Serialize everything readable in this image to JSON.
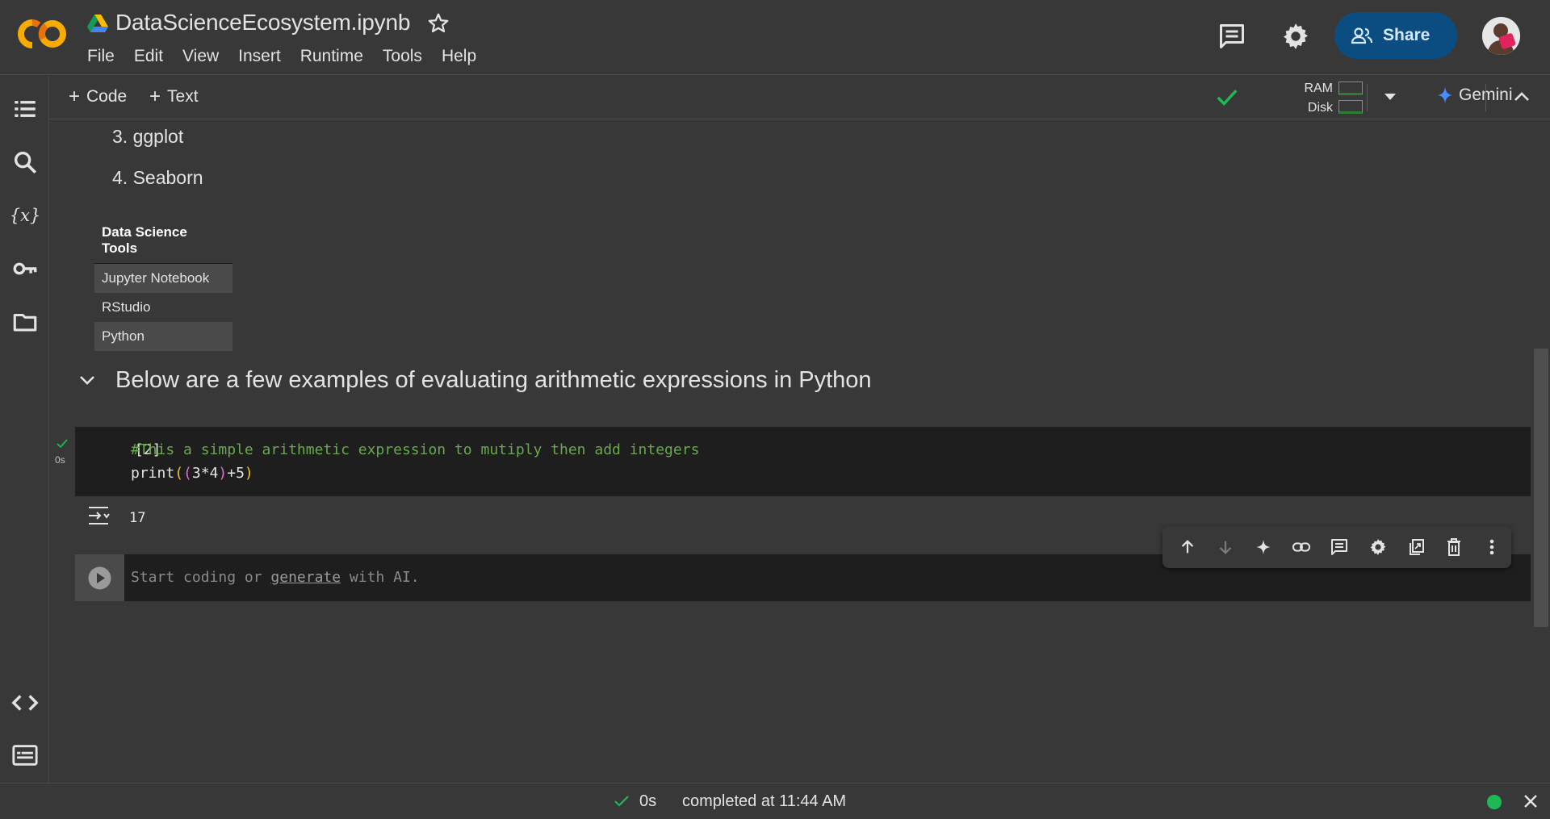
{
  "header": {
    "title": "DataScienceEcosystem.ipynb",
    "menu": [
      "File",
      "Edit",
      "View",
      "Insert",
      "Runtime",
      "Tools",
      "Help"
    ],
    "share_label": "Share",
    "logo_text": "CO",
    "icons": {
      "comments": "comment-icon",
      "settings": "gear-icon",
      "star": "star-icon",
      "drive": "google-drive-icon"
    }
  },
  "toolbar": {
    "add_code": "Code",
    "add_text": "Text",
    "ram_label": "RAM",
    "disk_label": "Disk",
    "gemini_label": "Gemini"
  },
  "notebook": {
    "list_items": [
      "3. ggplot",
      "4. Seaborn"
    ],
    "table": {
      "header": "Data Science Tools",
      "rows": [
        "Jupyter Notebook",
        "RStudio",
        "Python"
      ]
    },
    "section_heading": "Below are a few examples of evaluating arithmetic expressions in Python",
    "cell1": {
      "execution_count": "[2]",
      "duration": "0s",
      "code_line1": "#This a simple arithmetic expression to mutiply then add integers",
      "code_line2_fn": "print",
      "code_line2_inner": "3*4",
      "code_line2_tail": "+5",
      "output": "17"
    },
    "cell2": {
      "placeholder_start": "Start coding or ",
      "placeholder_link": "generate",
      "placeholder_end": " with AI."
    }
  },
  "status": {
    "duration": "0s",
    "message": "completed at 11:44 AM"
  },
  "colors": {
    "background": "#383838",
    "code_bg": "#1e1e1e",
    "accent_share": "#0b4d80",
    "success_green": "#1db954",
    "comment_green": "#6aa84f"
  }
}
